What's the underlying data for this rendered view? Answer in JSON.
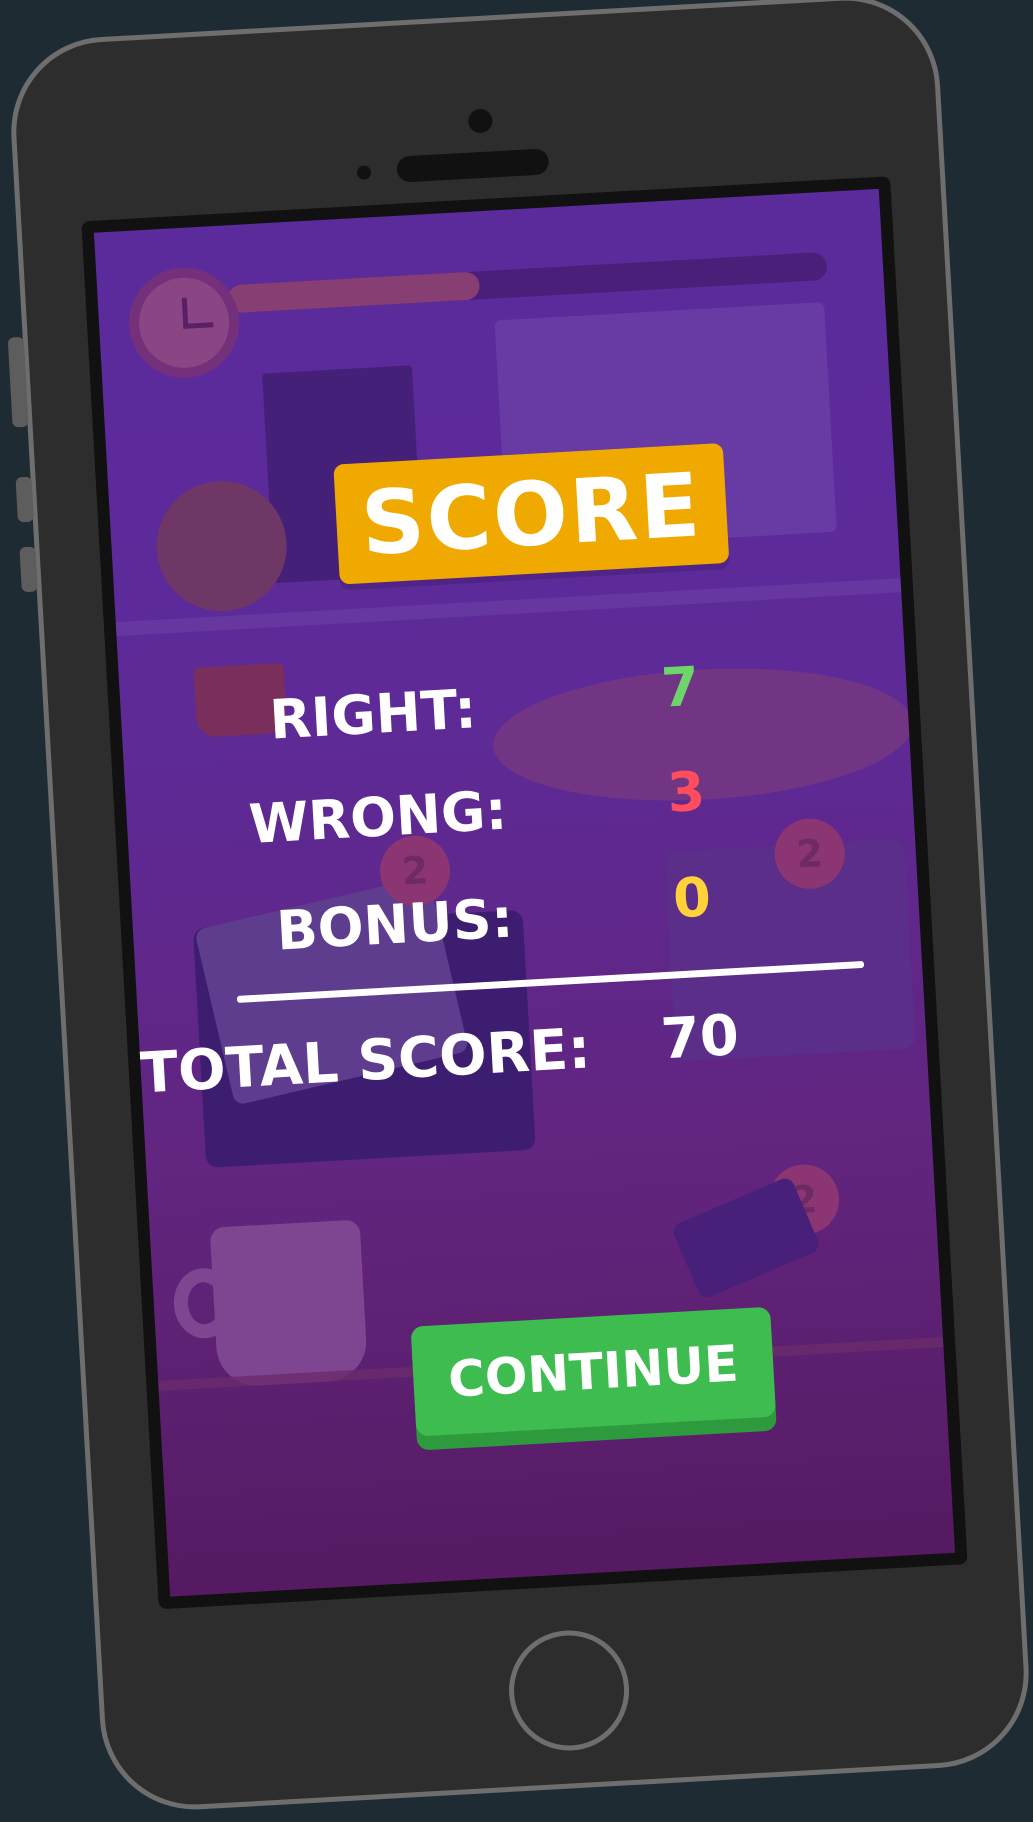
{
  "screen": {
    "title": "SCORE",
    "stats": [
      {
        "label": "RIGHT:",
        "value": "7"
      },
      {
        "label": "WRONG:",
        "value": "3"
      },
      {
        "label": "BONUS:",
        "value": "0"
      }
    ],
    "total": {
      "label": "TOTAL SCORE:",
      "value": "70"
    },
    "continue_label": "CONTINUE",
    "background_badges": [
      "2",
      "2",
      "2"
    ],
    "timer_progress": 0.42
  },
  "colors": {
    "title_banner": "#f0a900",
    "right_value": "#6cd66a",
    "wrong_value": "#ff4d5e",
    "bonus_value": "#ffd23a",
    "continue_button": "#3fbc4f",
    "screen_background": "#5b2b9c",
    "page_background": "#1f2b33"
  }
}
